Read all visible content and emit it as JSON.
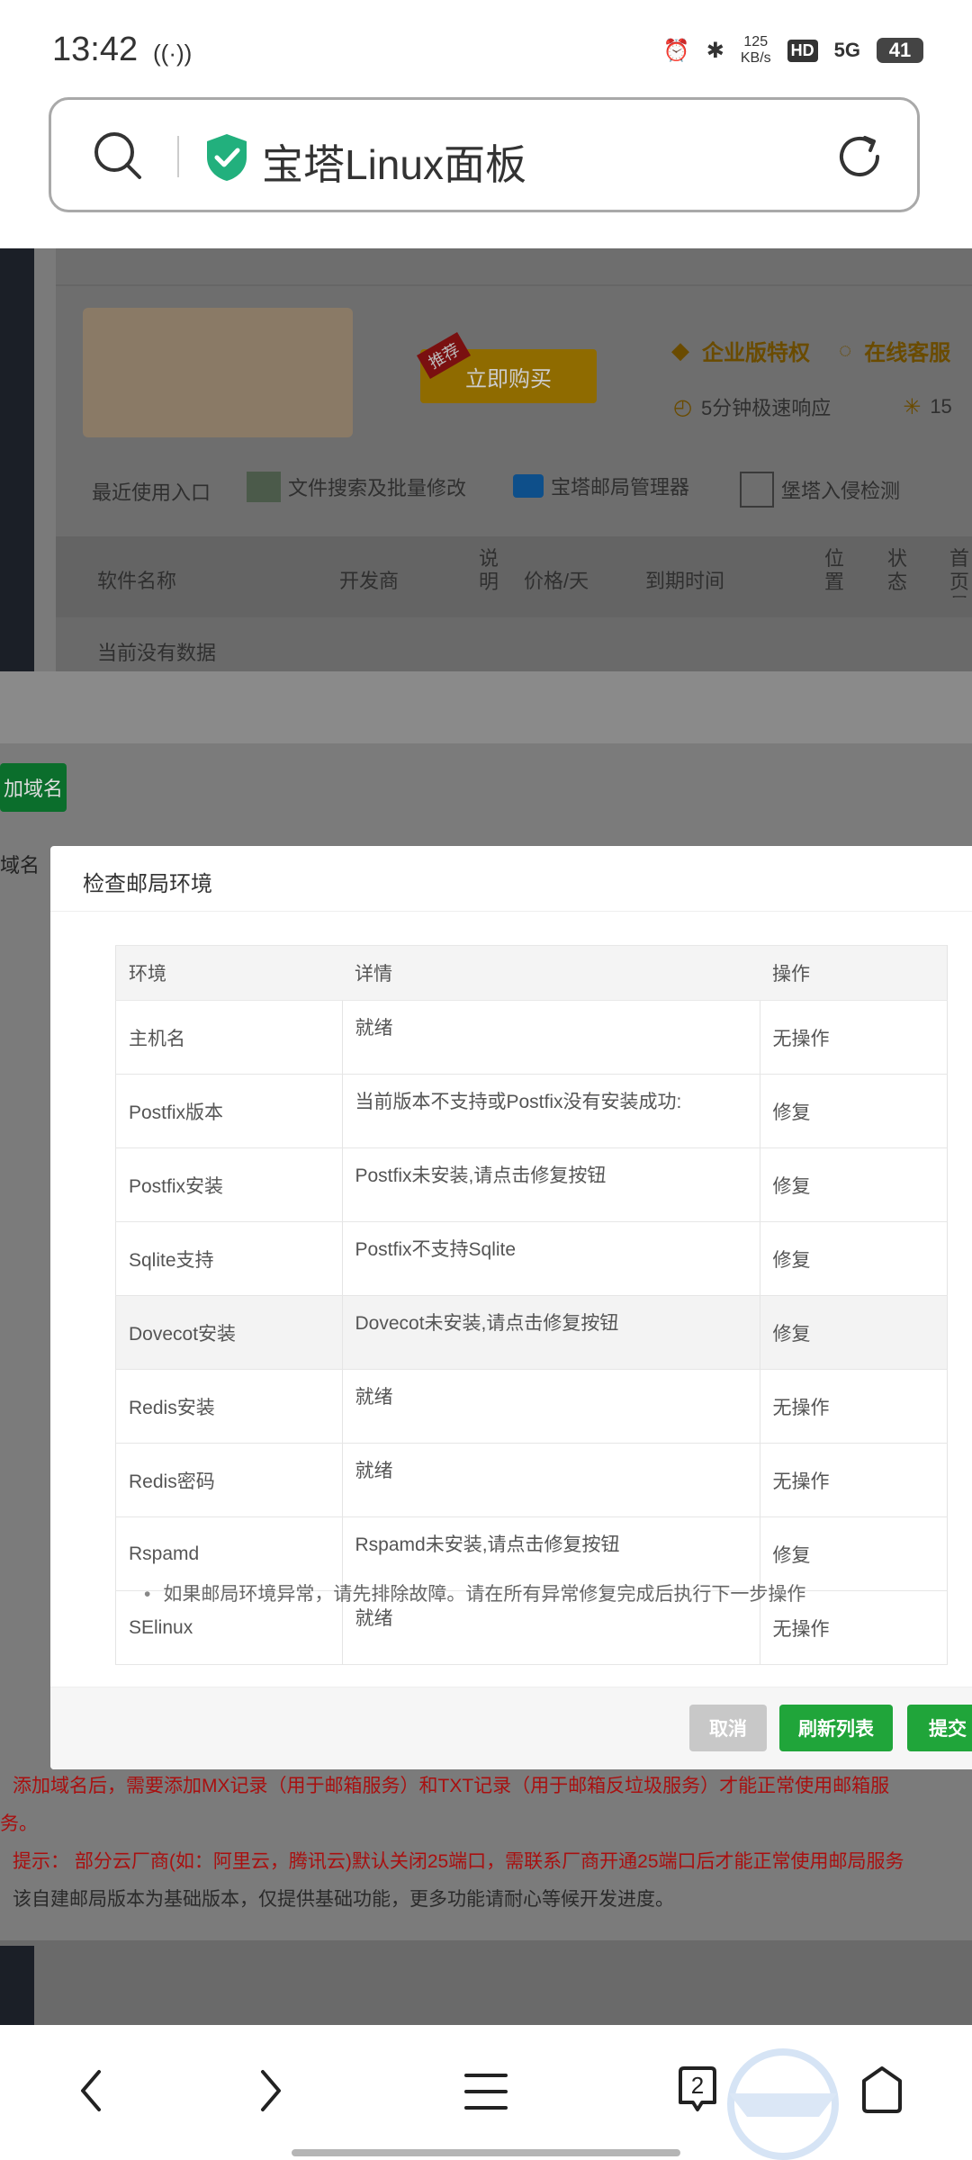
{
  "status_bar": {
    "time": "13:42",
    "net_speed": "125",
    "net_unit": "KB/s",
    "hd": "HD",
    "signal": "5G",
    "battery": "41"
  },
  "browser": {
    "url_title": "宝塔Linux面板"
  },
  "background_page": {
    "buy_button": "立即购买",
    "ribbon": "推荐",
    "enterprise": "企业版特权",
    "online_service": "在线客服",
    "response": "5分钟极速响应",
    "response_num": "15",
    "recent_label": "最近使用入口",
    "recent_items": [
      "文件搜索及批量修改",
      "宝塔邮局管理器",
      "堡塔入侵检测"
    ],
    "software_headers": [
      "软件名称",
      "开发商",
      "说明",
      "价格/天",
      "到期时间",
      "位置",
      "状态",
      "首页显示"
    ],
    "no_data": "当前没有数据",
    "add_domain": "加域名",
    "domain_col": "域名"
  },
  "modal": {
    "title": "检查邮局环境",
    "headers": [
      "环境",
      "详情",
      "操作"
    ],
    "rows": [
      {
        "env": "主机名",
        "detail": "就绪",
        "status": "ok",
        "action": "无操作"
      },
      {
        "env": "Postfix版本",
        "detail": "当前版本不支持或Postfix没有安装成功:",
        "status": "err",
        "action": "修复"
      },
      {
        "env": "Postfix安装",
        "detail": "Postfix未安装,请点击修复按钮",
        "status": "err",
        "action": "修复"
      },
      {
        "env": "Sqlite支持",
        "detail": "Postfix不支持Sqlite",
        "status": "err",
        "action": "修复"
      },
      {
        "env": "Dovecot安装",
        "detail": "Dovecot未安装,请点击修复按钮",
        "status": "err",
        "action": "修复"
      },
      {
        "env": "Redis安装",
        "detail": "就绪",
        "status": "ok",
        "action": "无操作"
      },
      {
        "env": "Redis密码",
        "detail": "就绪",
        "status": "ok",
        "action": "无操作"
      },
      {
        "env": "Rspamd",
        "detail": "Rspamd未安装,请点击修复按钮",
        "status": "err",
        "action": "修复"
      },
      {
        "env": "SElinux",
        "detail": "就绪",
        "status": "ok",
        "action": "无操作"
      }
    ],
    "note": "如果邮局环境异常，请先排除故障。请在所有异常修复完成后执行下一步操作",
    "buttons": {
      "cancel": "取消",
      "refresh": "刷新列表",
      "submit": "提交"
    }
  },
  "bottom_notes": {
    "line1": "添加域名后，需要添加MX记录（用于邮箱服务）和TXT记录（用于邮箱反垃圾服务）才能正常使用邮箱服",
    "line1_tail": "务。",
    "line2": "提示：  部分云厂商(如：阿里云，腾讯云)默认关闭25端口，需联系厂商开通25端口后才能正常使用邮局服务",
    "line3": "该自建邮局版本为基础版本，仅提供基础功能，更多功能请耐心等候开发进度。"
  },
  "nav": {
    "tabs_count": "2"
  }
}
